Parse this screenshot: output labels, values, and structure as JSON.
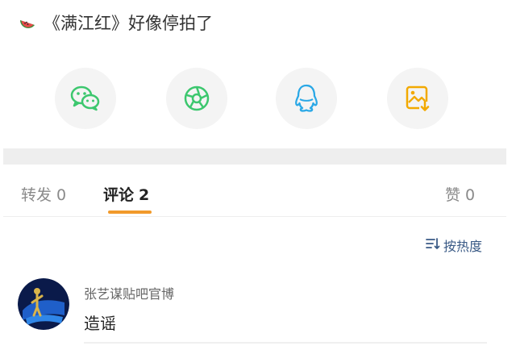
{
  "post": {
    "title": "《满江红》好像停拍了",
    "emoji": "watermelon-icon"
  },
  "share": {
    "buttons": [
      {
        "icon": "wechat-icon",
        "color": "#3cc76e"
      },
      {
        "icon": "wechat-moments-icon",
        "color": "#3cc76e"
      },
      {
        "icon": "qq-icon",
        "color": "#2aa8e6"
      },
      {
        "icon": "save-image-icon",
        "color": "#f2a900"
      }
    ]
  },
  "tabs": {
    "repost": {
      "label": "转发",
      "count": "0"
    },
    "comments": {
      "label": "评论",
      "count": "2"
    },
    "likes": {
      "label": "赞",
      "count": "0"
    },
    "active_color": "#f19a2b"
  },
  "sort": {
    "label": "按热度",
    "icon": "sort-icon"
  },
  "comments": [
    {
      "author": "张艺谋贴吧官博",
      "text": "造谣",
      "avatar": "avatar-icon"
    }
  ]
}
